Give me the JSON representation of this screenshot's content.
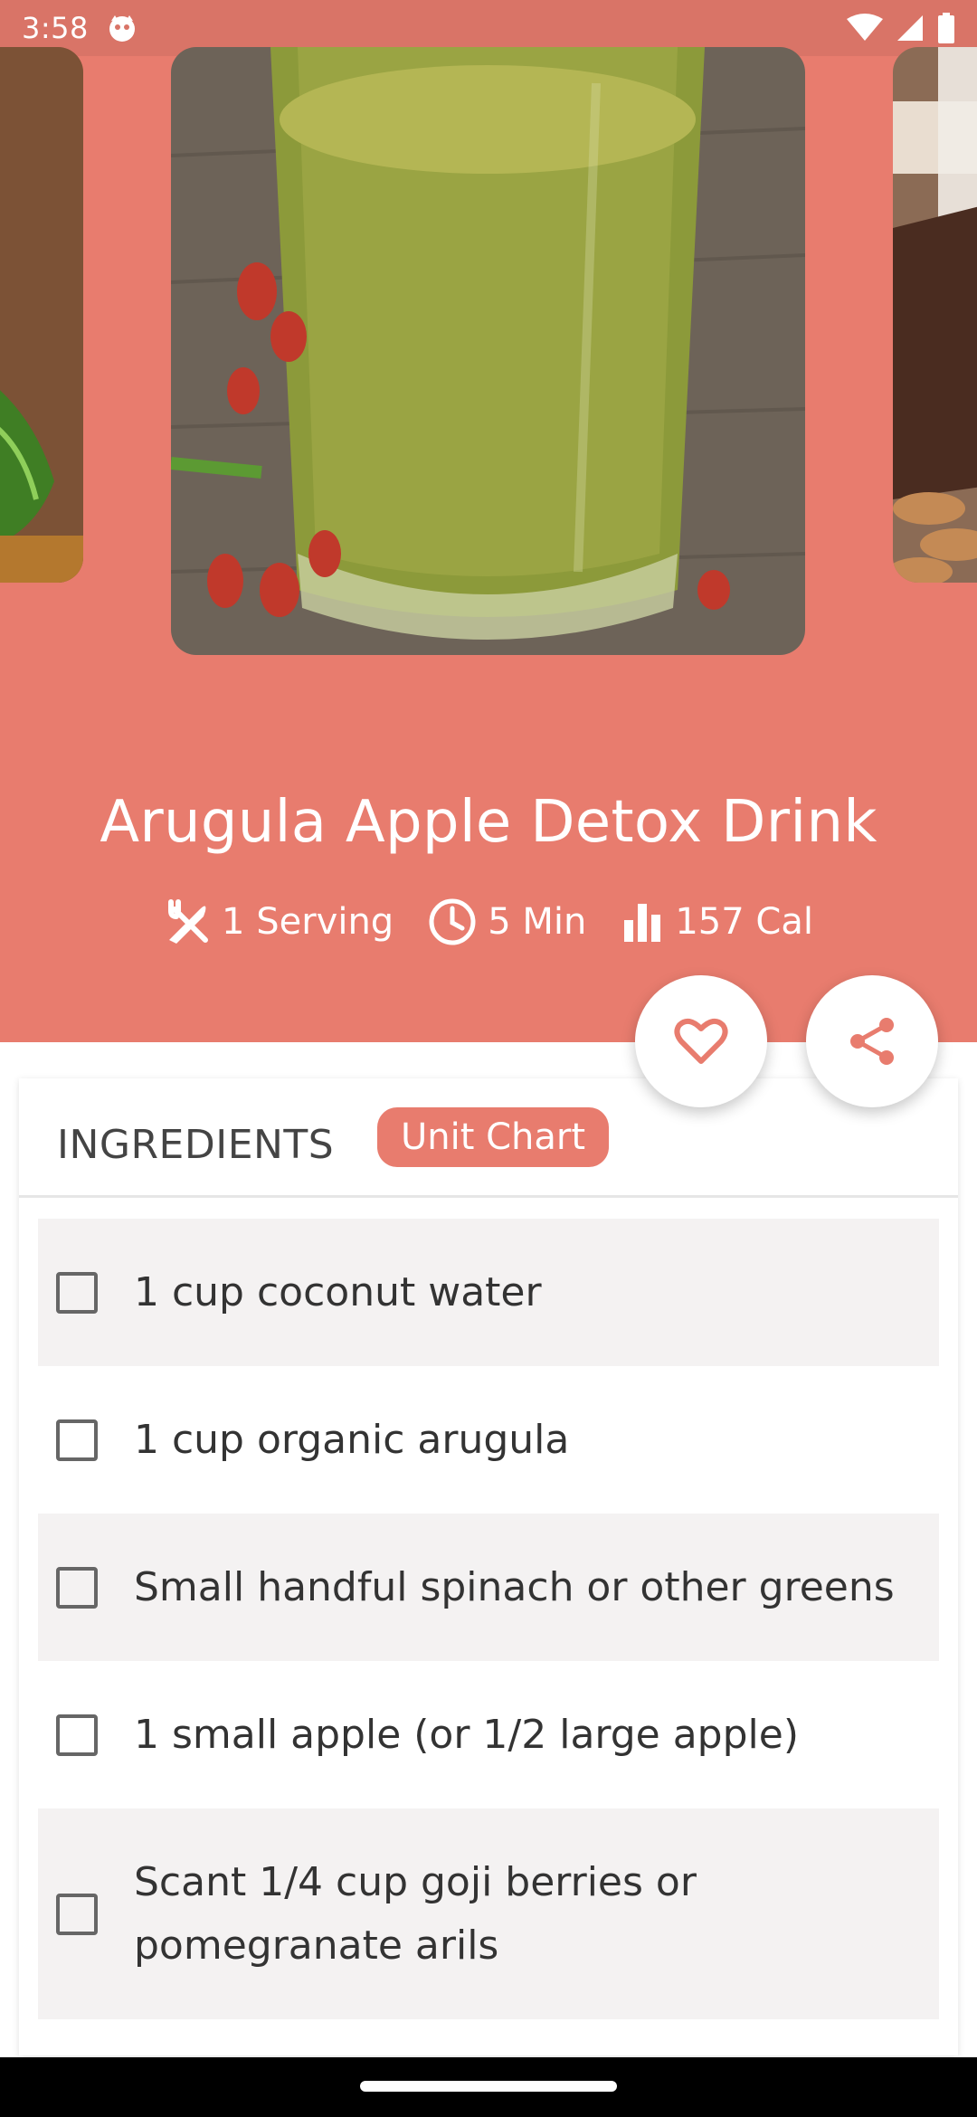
{
  "status_bar": {
    "time": "3:58"
  },
  "recipe": {
    "title": "Arugula Apple Detox Drink",
    "stats": [
      {
        "icon": "utensils-icon",
        "label": "1 Serving"
      },
      {
        "icon": "clock-icon",
        "label": "5 Min"
      },
      {
        "icon": "bar-chart-icon",
        "label": "157 Cal"
      }
    ]
  },
  "tabs": {
    "ingredients": "INGREDIENTS",
    "unit_chart": "Unit Chart"
  },
  "ingredients": [
    "1 cup coconut water",
    "1 cup organic arugula",
    "Small handful spinach or other greens",
    "1 small apple (or 1/2 large apple)",
    "Scant 1/4 cup goji berries or pomegranate arils"
  ],
  "colors": {
    "primary": "#e87c6e",
    "status_bar": "#d97467",
    "row_alt": "#f4f2f2"
  }
}
